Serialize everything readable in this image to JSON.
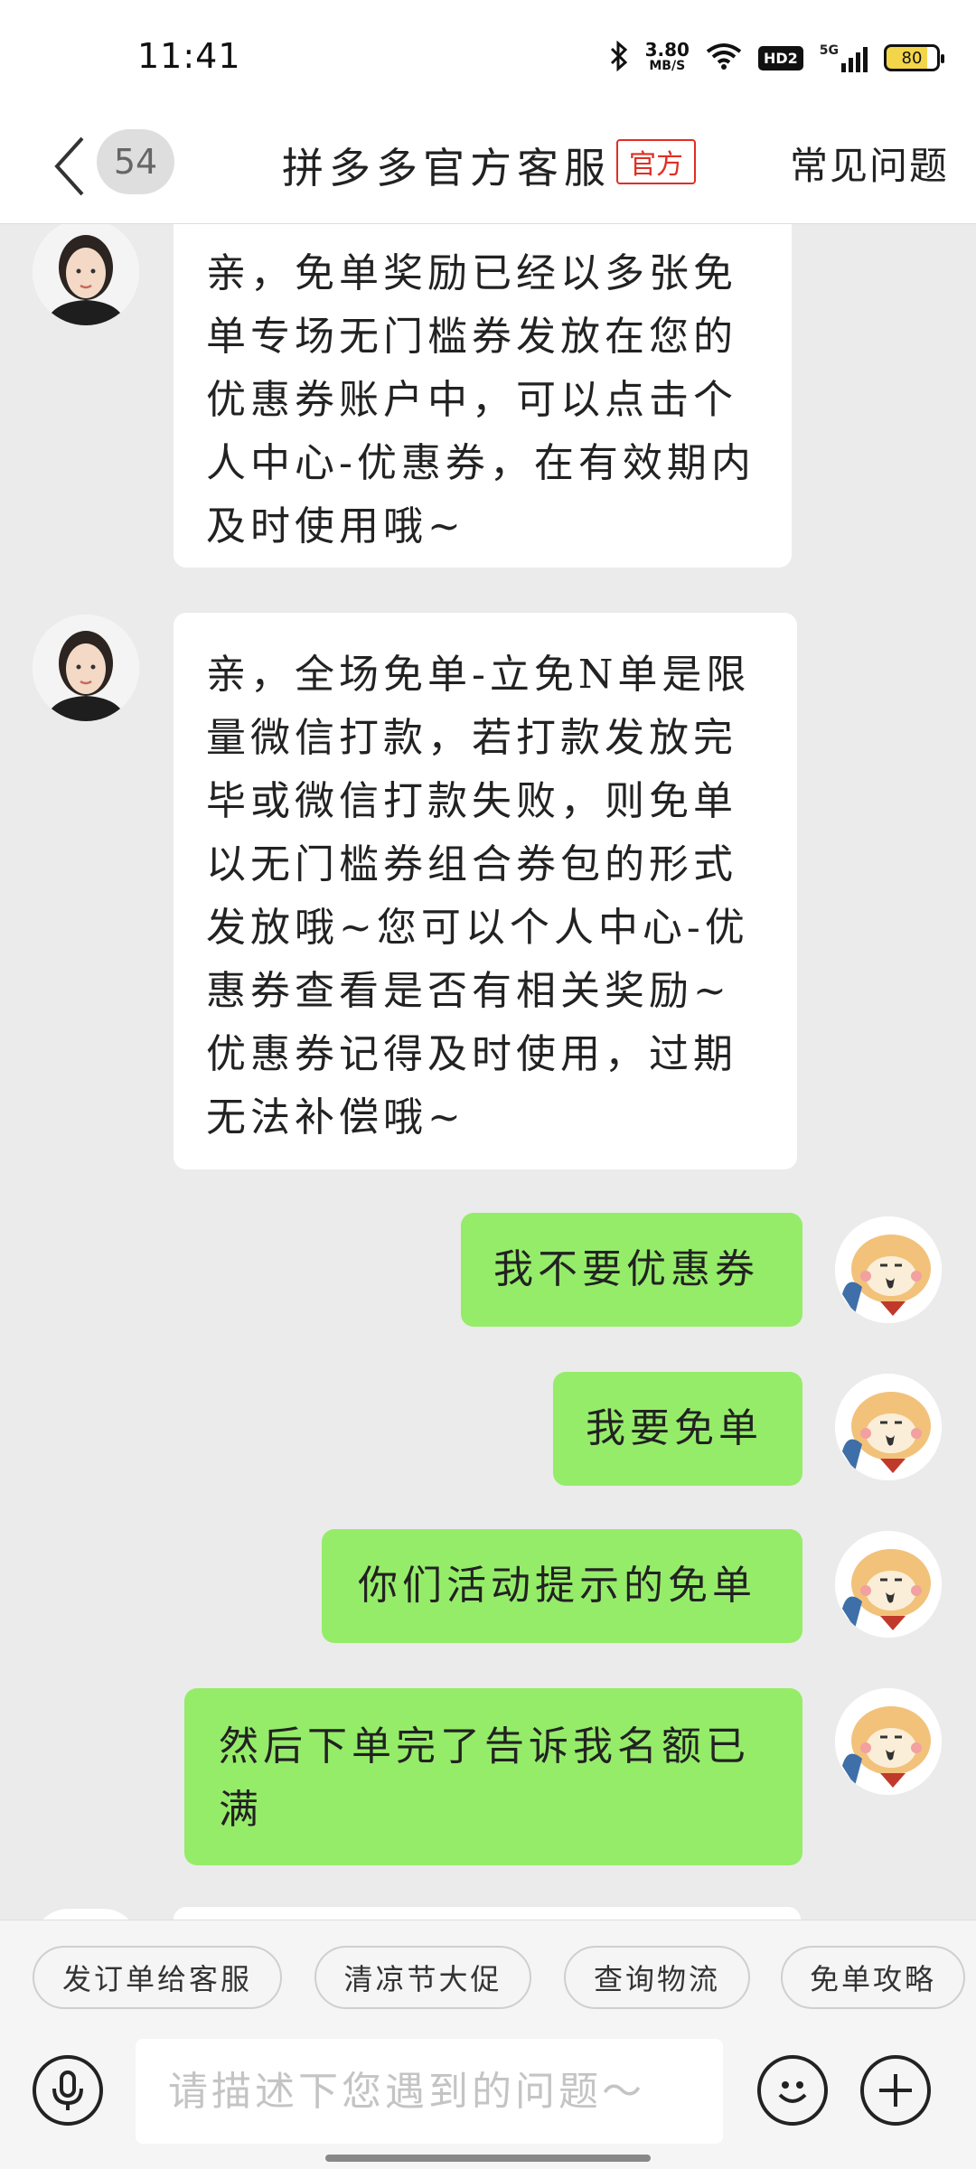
{
  "status_bar": {
    "time": "11:41",
    "net_speed_value": "3.80",
    "net_speed_unit": "MB/S",
    "hd_label": "HD2",
    "network_label": "5G",
    "battery": "80"
  },
  "header": {
    "unread_count": "54",
    "title": "拼多多官方客服",
    "official_tag": "官方",
    "faq_label": "常见问题"
  },
  "messages": [
    {
      "from": "agent",
      "text": "亲，免单奖励已经以多张免单专场无门槛券发放在您的优惠券账户中，可以点击个人中心-优惠券，在有效期内及时使用哦~"
    },
    {
      "from": "agent",
      "text": "亲，全场免单-立免N单是限量微信打款，若打款发放完毕或微信打款失败，则免单以无门槛券组合券包的形式发放哦~您可以个人中心-优惠券查看是否有相关奖励~优惠券记得及时使用，过期无法补偿哦~"
    },
    {
      "from": "user",
      "text": "我不要优惠券"
    },
    {
      "from": "user",
      "text": "我要免单"
    },
    {
      "from": "user",
      "text": "你们活动提示的免单"
    },
    {
      "from": "user",
      "text": "然后下单完了告诉我名额已满"
    }
  ],
  "quick_replies": [
    "发订单给客服",
    "清凉节大促",
    "查询物流",
    "免单攻略"
  ],
  "input": {
    "placeholder": "请描述下您遇到的问题～"
  },
  "colors": {
    "user_bubble": "#95ec69",
    "agent_bubble": "#ffffff",
    "official_red": "#e02e24",
    "background": "#ebebeb"
  }
}
